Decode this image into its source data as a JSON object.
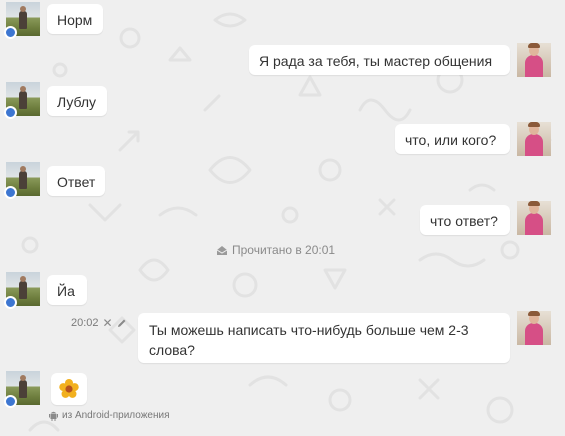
{
  "messages": [
    {
      "side": "in",
      "text": "Норм"
    },
    {
      "side": "out",
      "text": "Я рада за тебя, ты мастер общения"
    },
    {
      "side": "in",
      "text": "Лублу"
    },
    {
      "side": "out",
      "text": "что, или кого?"
    },
    {
      "side": "in",
      "text": "Ответ"
    },
    {
      "side": "out",
      "text": "что ответ?"
    },
    {
      "side": "in",
      "text": "Йа"
    },
    {
      "side": "out",
      "text": "Ты можешь написать что-нибудь больше чем 2-3 слова?",
      "time": "20:02"
    },
    {
      "side": "in",
      "emoji": "flower-emoji"
    }
  ],
  "read_status": "Прочитано в 20:01",
  "android_note": "из Android-приложения",
  "colors": {
    "background": "#efefef",
    "bubble": "#ffffff",
    "online_dot": "#3d76d1",
    "text": "#333333",
    "muted": "#8a8a8a"
  }
}
